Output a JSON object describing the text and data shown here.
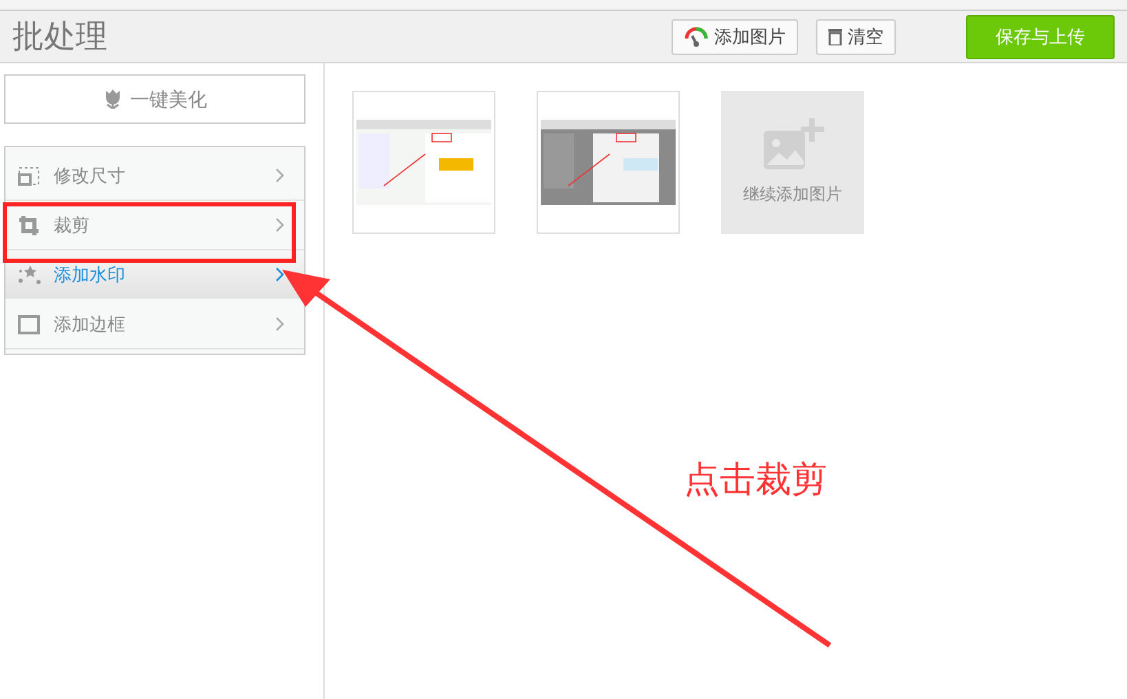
{
  "header": {
    "title": "批处理",
    "buttons": [
      {
        "kind": "add",
        "label": "添加图片"
      },
      {
        "kind": "clear",
        "label": "清空"
      }
    ],
    "primary": "保存与上传"
  },
  "sidebar": {
    "beautify": "一键美化",
    "items": [
      {
        "kind": "resize",
        "label": "修改尺寸",
        "selected": false,
        "highlighted": false
      },
      {
        "kind": "crop",
        "label": "裁剪",
        "selected": false,
        "highlighted": true
      },
      {
        "kind": "watermark",
        "label": "添加水印",
        "selected": true,
        "highlighted": false
      },
      {
        "kind": "border",
        "label": "添加边框",
        "selected": false,
        "highlighted": false
      }
    ]
  },
  "add_more": "继续添加图片",
  "annotation": {
    "caption": "点击裁剪"
  }
}
